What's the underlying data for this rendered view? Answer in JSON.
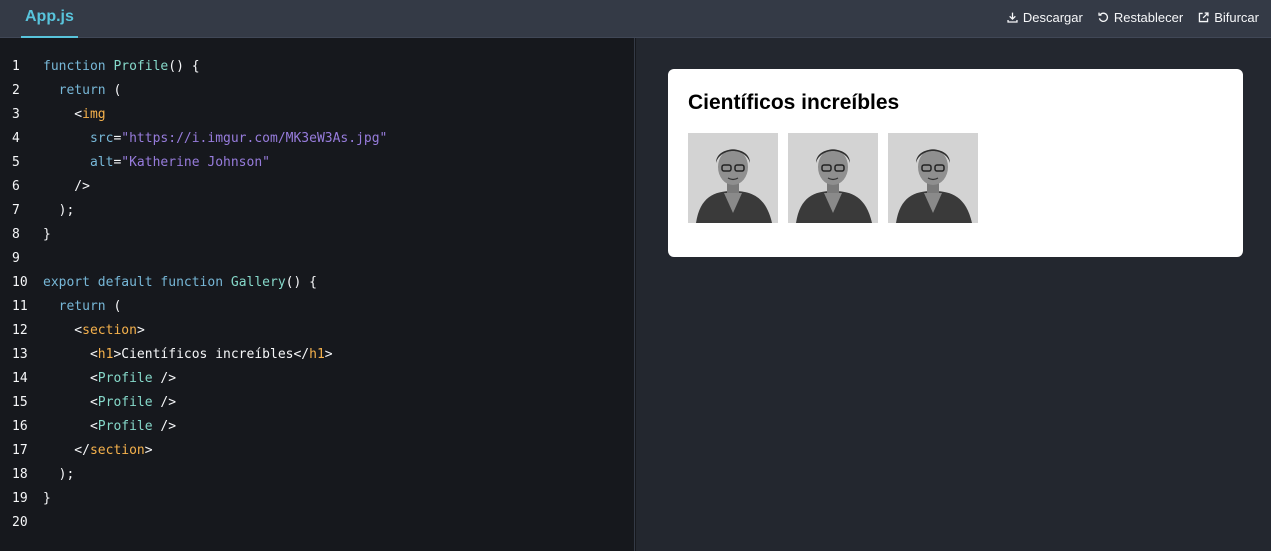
{
  "tabs": [
    {
      "label": "App.js"
    }
  ],
  "toolbar": {
    "download_label": "Descargar",
    "reset_label": "Restablecer",
    "fork_label": "Bifurcar",
    "download_icon": "download-icon",
    "reset_icon": "reset-icon",
    "fork_icon": "external-link-icon"
  },
  "editor": {
    "line_numbers": [
      "1",
      "2",
      "3",
      "4",
      "5",
      "6",
      "7",
      "8",
      "9",
      "10",
      "11",
      "12",
      "13",
      "14",
      "15",
      "16",
      "17",
      "18",
      "19",
      "20"
    ],
    "lines": [
      [
        [
          "kw",
          "function"
        ],
        [
          "pn",
          " "
        ],
        [
          "fn",
          "Profile"
        ],
        [
          "pn",
          "() {"
        ]
      ],
      [
        [
          "pn",
          "  "
        ],
        [
          "kw",
          "return"
        ],
        [
          "pn",
          " ("
        ]
      ],
      [
        [
          "pn",
          "    <"
        ],
        [
          "tg",
          "img"
        ]
      ],
      [
        [
          "pn",
          "      "
        ],
        [
          "at",
          "src"
        ],
        [
          "pn",
          "="
        ],
        [
          "st",
          "\"https://i.imgur.com/MK3eW3As.jpg\""
        ]
      ],
      [
        [
          "pn",
          "      "
        ],
        [
          "at",
          "alt"
        ],
        [
          "pn",
          "="
        ],
        [
          "st",
          "\"Katherine Johnson\""
        ]
      ],
      [
        [
          "pn",
          "    />"
        ]
      ],
      [
        [
          "pn",
          "  );"
        ]
      ],
      [
        [
          "pn",
          "}"
        ]
      ],
      [],
      [
        [
          "kw",
          "export"
        ],
        [
          "pn",
          " "
        ],
        [
          "kw",
          "default"
        ],
        [
          "pn",
          " "
        ],
        [
          "kw",
          "function"
        ],
        [
          "pn",
          " "
        ],
        [
          "fn",
          "Gallery"
        ],
        [
          "pn",
          "() {"
        ]
      ],
      [
        [
          "pn",
          "  "
        ],
        [
          "kw",
          "return"
        ],
        [
          "pn",
          " ("
        ]
      ],
      [
        [
          "pn",
          "    <"
        ],
        [
          "tg",
          "section"
        ],
        [
          "pn",
          ">"
        ]
      ],
      [
        [
          "pn",
          "      <"
        ],
        [
          "tg",
          "h1"
        ],
        [
          "pn",
          ">Científicos increíbles</"
        ],
        [
          "tg",
          "h1"
        ],
        [
          "pn",
          ">"
        ]
      ],
      [
        [
          "pn",
          "      <"
        ],
        [
          "comp",
          "Profile"
        ],
        [
          "pn",
          " />"
        ]
      ],
      [
        [
          "pn",
          "      <"
        ],
        [
          "comp",
          "Profile"
        ],
        [
          "pn",
          " />"
        ]
      ],
      [
        [
          "pn",
          "      <"
        ],
        [
          "comp",
          "Profile"
        ],
        [
          "pn",
          " />"
        ]
      ],
      [
        [
          "pn",
          "    </"
        ],
        [
          "tg",
          "section"
        ],
        [
          "pn",
          ">"
        ]
      ],
      [
        [
          "pn",
          "  );"
        ]
      ],
      [
        [
          "pn",
          "}"
        ]
      ],
      []
    ]
  },
  "preview": {
    "heading": "Científicos increíbles",
    "images": [
      {
        "alt": "Katherine Johnson"
      },
      {
        "alt": "Katherine Johnson"
      },
      {
        "alt": "Katherine Johnson"
      }
    ]
  },
  "colors": {
    "accent": "#58c4dc",
    "editor_bg": "#16181d",
    "preview_bg": "#23272f",
    "topbar_bg": "#343a46"
  }
}
